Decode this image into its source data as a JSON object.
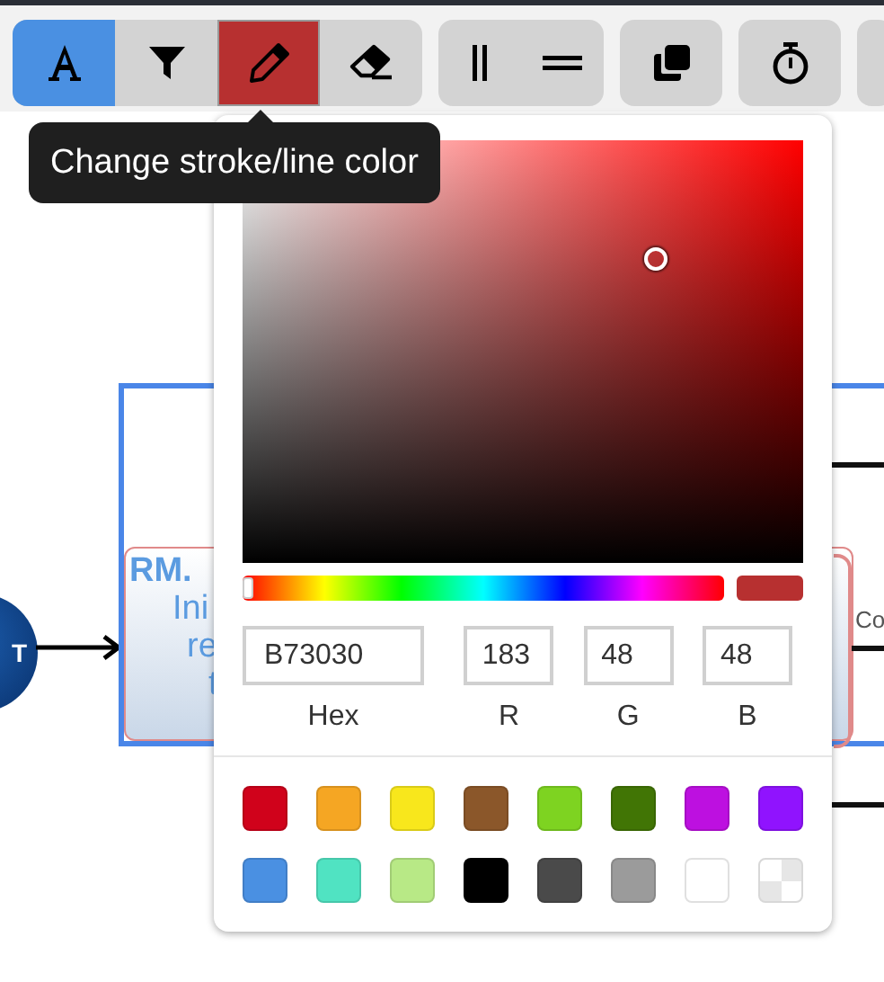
{
  "toolbar": {
    "groups": [
      {
        "tools": [
          {
            "kind": "text",
            "selected": true
          },
          {
            "kind": "filter",
            "selected": false
          },
          {
            "kind": "pencil",
            "selected": false
          },
          {
            "kind": "eraser",
            "selected": false
          }
        ]
      },
      {
        "tools": [
          {
            "kind": "parallel",
            "selected": false
          },
          {
            "kind": "equal",
            "selected": false
          }
        ]
      },
      {
        "tools": [
          {
            "kind": "copy",
            "selected": false
          }
        ]
      },
      {
        "tools": [
          {
            "kind": "timer",
            "selected": false
          }
        ]
      },
      {
        "kind": "partial"
      }
    ]
  },
  "tooltip": {
    "text": "Change stroke/line color"
  },
  "diagram": {
    "start_label": "T",
    "card_lines": [
      "RM.",
      "Ini",
      "re",
      "t"
    ],
    "side_label": "Co"
  },
  "color_picker": {
    "hue": {
      "level": 0
    },
    "hex": "B73030",
    "r": "183",
    "g": "48",
    "b": "48",
    "labels": [
      "Hex",
      "R",
      "G",
      "B"
    ],
    "swatches": [
      {
        "kind": "color",
        "color": "#d0021b"
      },
      {
        "kind": "color",
        "color": "#f5a623"
      },
      {
        "kind": "color",
        "color": "#f8e71c"
      },
      {
        "kind": "color",
        "color": "#8b572a"
      },
      {
        "kind": "color",
        "color": "#7ed321"
      },
      {
        "kind": "color",
        "color": "#417505"
      },
      {
        "kind": "color",
        "color": "#bd10e0"
      },
      {
        "kind": "color",
        "color": "#9013fe"
      },
      {
        "kind": "color",
        "color": "#4a90e2"
      },
      {
        "kind": "color",
        "color": "#50e3c2"
      },
      {
        "kind": "color",
        "color": "#b8e986"
      },
      {
        "kind": "color",
        "color": "#000000"
      },
      {
        "kind": "color",
        "color": "#4a4a4a"
      },
      {
        "kind": "color",
        "color": "#9b9b9b"
      },
      {
        "kind": "color",
        "color": "#ffffff"
      },
      {
        "kind": "transparent"
      }
    ]
  }
}
